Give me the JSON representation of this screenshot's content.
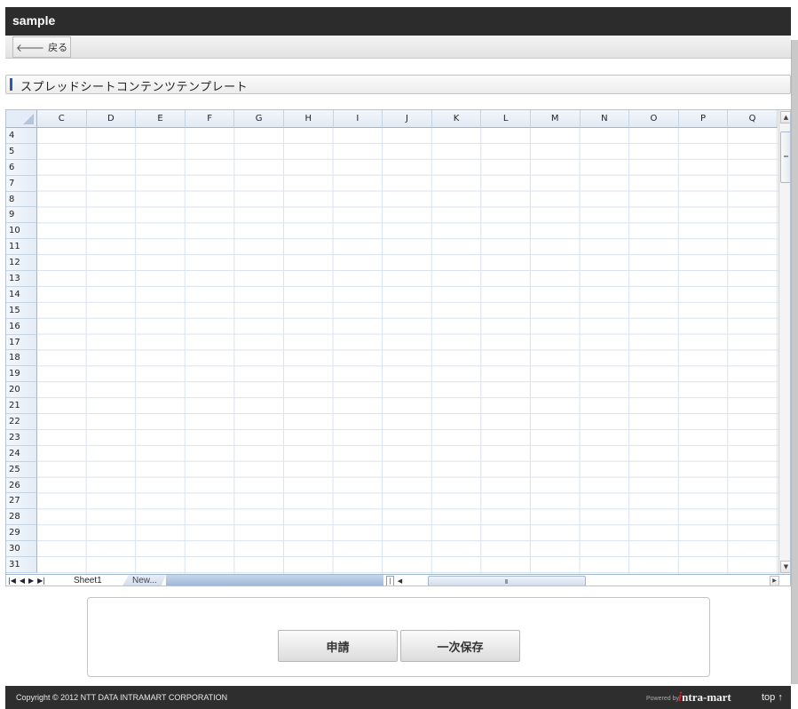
{
  "app": {
    "title": "sample"
  },
  "toolbar": {
    "back_label": "戻る",
    "back_icon": "arrow-left-icon"
  },
  "section": {
    "title": "スプレッドシートコンテンツテンプレート",
    "accent": "#2a5aa8"
  },
  "spreadsheet": {
    "columns": [
      "C",
      "D",
      "E",
      "F",
      "G",
      "H",
      "I",
      "J",
      "K",
      "L",
      "M",
      "N",
      "O",
      "P",
      "Q"
    ],
    "rows": [
      "4",
      "5",
      "6",
      "7",
      "8",
      "9",
      "10",
      "11",
      "12",
      "13",
      "14",
      "15",
      "16",
      "17",
      "18",
      "19",
      "20",
      "21",
      "22",
      "23",
      "24",
      "25",
      "26",
      "27",
      "28",
      "29",
      "30",
      "31"
    ],
    "sheet_tabs": {
      "active": "Sheet1",
      "new": "New..."
    },
    "nav_icons": [
      "first-sheet-icon",
      "prev-sheet-icon",
      "next-sheet-icon",
      "last-sheet-icon"
    ]
  },
  "actions": {
    "apply_label": "申請",
    "save_label": "一次保存"
  },
  "footer": {
    "copyright": "Copyright © 2012 NTT DATA INTRAMART CORPORATION",
    "powered_by": "Powered by",
    "logo": "ntra-mart",
    "logo_initial": "i",
    "top_link": "top ↑"
  }
}
